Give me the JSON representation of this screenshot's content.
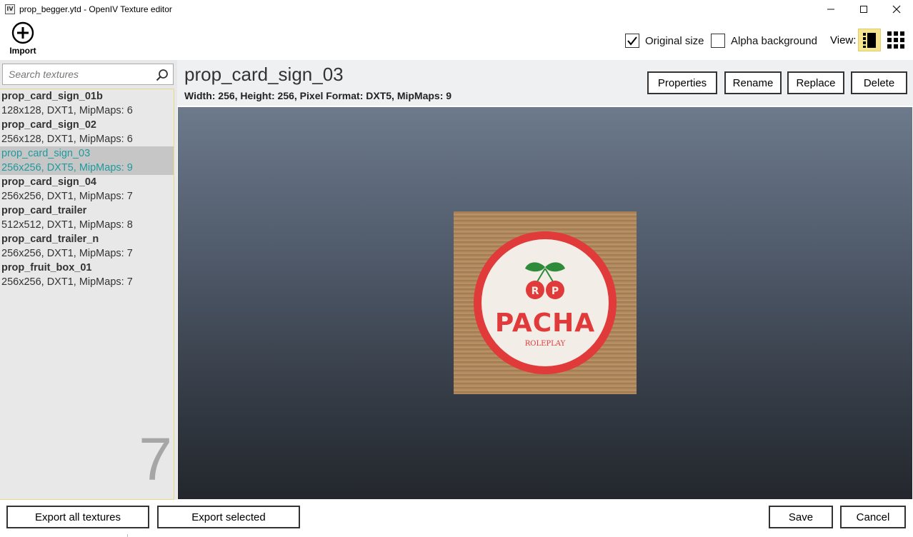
{
  "window": {
    "app_icon_text": "IV",
    "title": "prop_begger.ytd - OpenIV Texture editor",
    "minimize_glyph": "—",
    "maximize_glyph": "☐",
    "close_glyph": "✕"
  },
  "toolbar": {
    "import_label": "Import",
    "original_size_label": "Original size",
    "original_size_checked": true,
    "alpha_background_label": "Alpha background",
    "alpha_background_checked": false,
    "view_label": "View:",
    "view_mode": "list"
  },
  "search": {
    "placeholder": "Search textures",
    "value": ""
  },
  "textures": [
    {
      "name": "prop_card_sign_01b",
      "info": "128x128, DXT1, MipMaps: 6",
      "selected": false
    },
    {
      "name": "prop_card_sign_02",
      "info": "256x128, DXT1, MipMaps: 6",
      "selected": false
    },
    {
      "name": "prop_card_sign_03",
      "info": "256x256, DXT5, MipMaps: 9",
      "selected": true
    },
    {
      "name": "prop_card_sign_04",
      "info": "256x256, DXT1, MipMaps: 7",
      "selected": false
    },
    {
      "name": "prop_card_trailer",
      "info": "512x512, DXT1, MipMaps: 8",
      "selected": false
    },
    {
      "name": "prop_card_trailer_n",
      "info": "256x256, DXT1, MipMaps: 7",
      "selected": false
    },
    {
      "name": "prop_fruit_box_01",
      "info": "256x256, DXT1, MipMaps: 7",
      "selected": false
    }
  ],
  "texture_count": "7",
  "selected_texture": {
    "name": "prop_card_sign_03",
    "details": "Width: 256, Height: 256, Pixel Format: DXT5, MipMaps: 9",
    "image_text_main": "PACHA",
    "image_text_sub": "ROLEPLAY"
  },
  "actions": {
    "properties": "Properties",
    "rename": "Rename",
    "replace": "Replace",
    "delete": "Delete"
  },
  "footer": {
    "export_all": "Export all textures",
    "export_selected": "Export selected",
    "save": "Save",
    "cancel": "Cancel"
  },
  "colors": {
    "accent_selected_text": "#1e9aa0",
    "view_active_bg": "#f6e58d",
    "preview_top": "#6c7a8c",
    "preview_bottom": "#23272d",
    "logo_red": "#e03a3a"
  }
}
